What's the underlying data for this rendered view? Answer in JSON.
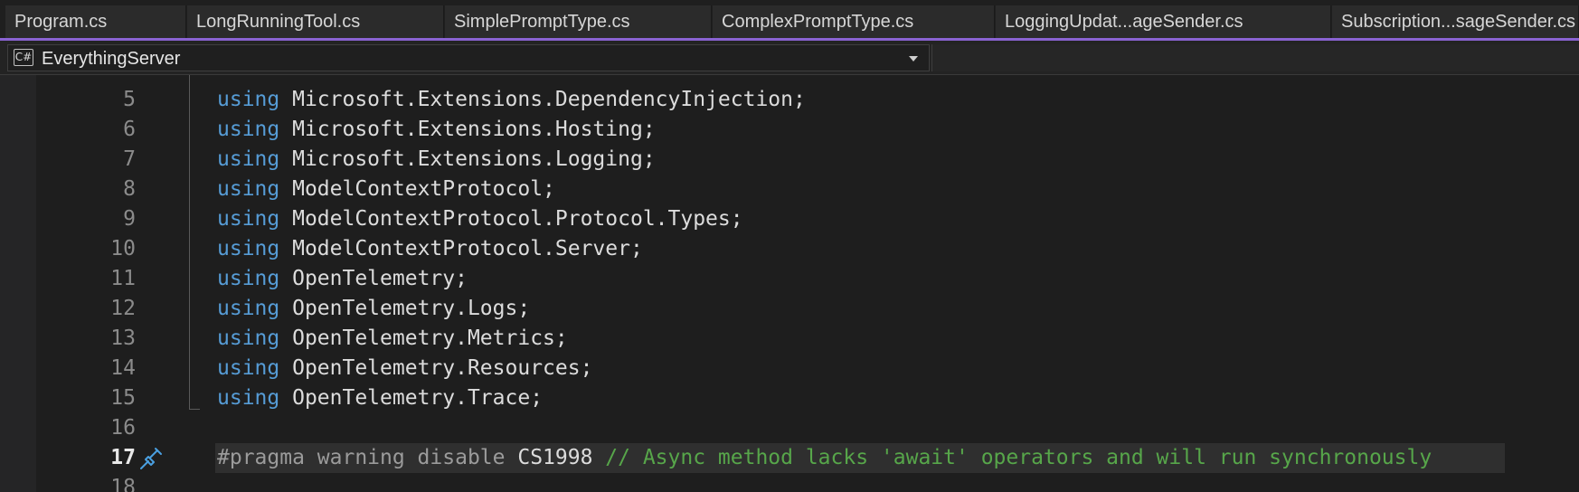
{
  "tabs": [
    {
      "label": "Program.cs"
    },
    {
      "label": "LongRunningTool.cs"
    },
    {
      "label": "SimplePromptType.cs"
    },
    {
      "label": "ComplexPromptType.cs"
    },
    {
      "label": "LoggingUpdat...ageSender.cs"
    },
    {
      "label": "Subscription...sageSender.cs"
    }
  ],
  "navbar": {
    "project_icon": "csharp-project-icon",
    "project_icon_text": "C#",
    "project_label": "EverythingServer",
    "dropdown_icon": "chevron-down-icon"
  },
  "editor": {
    "lines": [
      {
        "number": "5",
        "keyword": "using",
        "text": " Microsoft.Extensions.DependencyInjection;"
      },
      {
        "number": "6",
        "keyword": "using",
        "text": " Microsoft.Extensions.Hosting;"
      },
      {
        "number": "7",
        "keyword": "using",
        "text": " Microsoft.Extensions.Logging;"
      },
      {
        "number": "8",
        "keyword": "using",
        "text": " ModelContextProtocol;"
      },
      {
        "number": "9",
        "keyword": "using",
        "text": " ModelContextProtocol.Protocol.Types;"
      },
      {
        "number": "10",
        "keyword": "using",
        "text": " ModelContextProtocol.Server;"
      },
      {
        "number": "11",
        "keyword": "using",
        "text": " OpenTelemetry;"
      },
      {
        "number": "12",
        "keyword": "using",
        "text": " OpenTelemetry.Logs;"
      },
      {
        "number": "13",
        "keyword": "using",
        "text": " OpenTelemetry.Metrics;"
      },
      {
        "number": "14",
        "keyword": "using",
        "text": " OpenTelemetry.Resources;"
      },
      {
        "number": "15",
        "keyword": "using",
        "text": " OpenTelemetry.Trace;"
      },
      {
        "number": "16",
        "keyword": "",
        "text": ""
      }
    ],
    "pragma_line": {
      "number": "17",
      "directive": "#pragma warning disable",
      "code": " CS1998 ",
      "comment": "// Async method lacks 'await' operators and will run synchronously"
    },
    "last_line": {
      "number": "18"
    },
    "quick_action_icon": "screwdriver-quick-action-icon",
    "colors": {
      "keyword": "#569cd6",
      "comment": "#57a64a",
      "tab_accent": "#8a63d2"
    }
  }
}
